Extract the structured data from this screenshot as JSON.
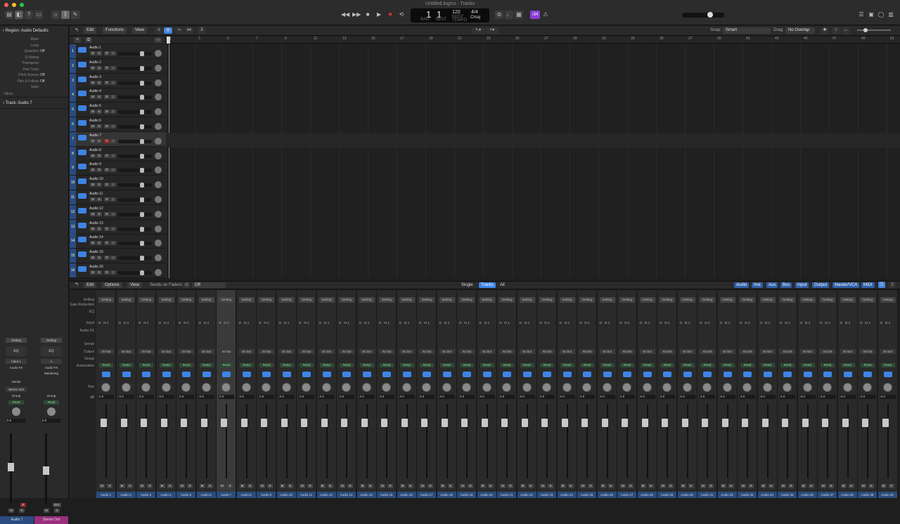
{
  "window": {
    "title": "Untitled.logicx - Tracks"
  },
  "colors": {
    "accent": "#3e84e6",
    "track_blue": "#2a4c7e",
    "record": "#e0322d",
    "read_green": "#8fd19e",
    "key_badge": "#8a3fd1"
  },
  "lcd": {
    "bar": "1",
    "beat": "1",
    "bar_label": "BAR",
    "beat_label": "BEAT",
    "tempo": "120",
    "tempo_label": "KEEP",
    "tempo_sub": "TEMPO",
    "time_sig": "4/4",
    "key": "Cmaj"
  },
  "toolbar": {
    "key_badge": "›34"
  },
  "tracks_toolbar": {
    "edit": "Edit",
    "functions": "Functions",
    "view": "View",
    "snap_label": "Snap:",
    "snap_value": "Smart",
    "drag_label": "Drag:",
    "drag_value": "No Overlap"
  },
  "inspector": {
    "region_header": "Region: Audio Defaults",
    "params": [
      {
        "k": "Mute:",
        "v": ""
      },
      {
        "k": "Loop:",
        "v": ""
      },
      {
        "k": "Quantize:",
        "v": "Off"
      },
      {
        "k": "Q-Swing:",
        "v": ""
      },
      {
        "k": "Transpose:",
        "v": ""
      },
      {
        "k": "Fine Tune:",
        "v": ""
      },
      {
        "k": "Pitch Source:",
        "v": "Off"
      },
      {
        "k": "Flex & Follow:",
        "v": "Off"
      },
      {
        "k": "Gain:",
        "v": ""
      }
    ],
    "more": "More",
    "track_header": "Track: Audio 7",
    "strip_left": {
      "setting": "Setting",
      "eq": "EQ",
      "input": "Input 1",
      "audio_fx": "Audio FX",
      "sends": "Sends",
      "output": "Stereo Out",
      "group": "Group",
      "read": "Read",
      "db": "0.0",
      "name": "Audio 7"
    },
    "strip_right": {
      "setting": "Setting",
      "eq": "EQ",
      "input": "∞",
      "audio_fx": "Audio FX",
      "plugin": "Mastering",
      "group": "Group",
      "read": "Read",
      "db": "0.0",
      "bnc": "Bnc",
      "name": "Stereo Out"
    }
  },
  "ruler": {
    "marks": [
      "1",
      "3",
      "5",
      "7",
      "9",
      "11",
      "13",
      "15",
      "17",
      "19",
      "21",
      "23",
      "25",
      "27",
      "29",
      "31",
      "33",
      "35",
      "37",
      "39",
      "41",
      "43",
      "45",
      "47",
      "49",
      "51"
    ]
  },
  "tracks": [
    {
      "num": "1",
      "name": "Audio 1"
    },
    {
      "num": "2",
      "name": "Audio 2"
    },
    {
      "num": "3",
      "name": "Audio 3"
    },
    {
      "num": "4",
      "name": "Audio 4"
    },
    {
      "num": "5",
      "name": "Audio 5"
    },
    {
      "num": "6",
      "name": "Audio 6"
    },
    {
      "num": "7",
      "name": "Audio 7"
    },
    {
      "num": "8",
      "name": "Audio 8"
    },
    {
      "num": "9",
      "name": "Audio 9"
    },
    {
      "num": "10",
      "name": "Audio 10"
    },
    {
      "num": "11",
      "name": "Audio 11"
    },
    {
      "num": "12",
      "name": "Audio 12"
    },
    {
      "num": "13",
      "name": "Audio 13"
    },
    {
      "num": "14",
      "name": "Audio 14"
    },
    {
      "num": "15",
      "name": "Audio 15"
    },
    {
      "num": "16",
      "name": "Audio 16"
    }
  ],
  "track_buttons": {
    "m": "M",
    "s": "S",
    "r": "R",
    "i": "I"
  },
  "mixer": {
    "edit": "Edit",
    "options": "Options",
    "view": "View",
    "sends_on_faders": "Sends on Faders:",
    "sends_value": "Off",
    "views": [
      "Single",
      "Tracks",
      "All"
    ],
    "filters": [
      "Audio",
      "Inst",
      "Aux",
      "Bus",
      "Input",
      "Output",
      "Master/VCA",
      "MIDI"
    ],
    "row_labels": [
      "Setting",
      "Gain Reduction",
      "EQ",
      "Input",
      "Audio FX",
      "Sends",
      "Output",
      "Group",
      "Automation",
      "Pan",
      "dB"
    ],
    "setting": "Setting",
    "input_icon": "O",
    "input": "In 1",
    "output": "St Out",
    "read": "Read",
    "db": "0.0",
    "m": "M",
    "s": "S",
    "strips": [
      "Audio 1",
      "Audio 2",
      "Audio 3",
      "Audio 4",
      "Audio 5",
      "Audio 6",
      "Audio 7",
      "Audio 8",
      "Audio 9",
      "Audio 10",
      "Audio 11",
      "Audio 12",
      "Audio 13",
      "Audio 14",
      "Audio 15",
      "Audio 16",
      "Audio 17",
      "Audio 18",
      "Audio 19",
      "Audio 20",
      "Audio 21",
      "Audio 22",
      "Audio 23",
      "Audio 24",
      "Audio 25",
      "Audio 26",
      "Audio 27",
      "Audio 28",
      "Audio 29",
      "Audio 30",
      "Audio 31",
      "Audio 32",
      "Audio 33",
      "Audio 34",
      "Audio 35",
      "Audio 36",
      "Audio 37",
      "Audio 38",
      "Audio 39",
      "Audio 40"
    ]
  }
}
